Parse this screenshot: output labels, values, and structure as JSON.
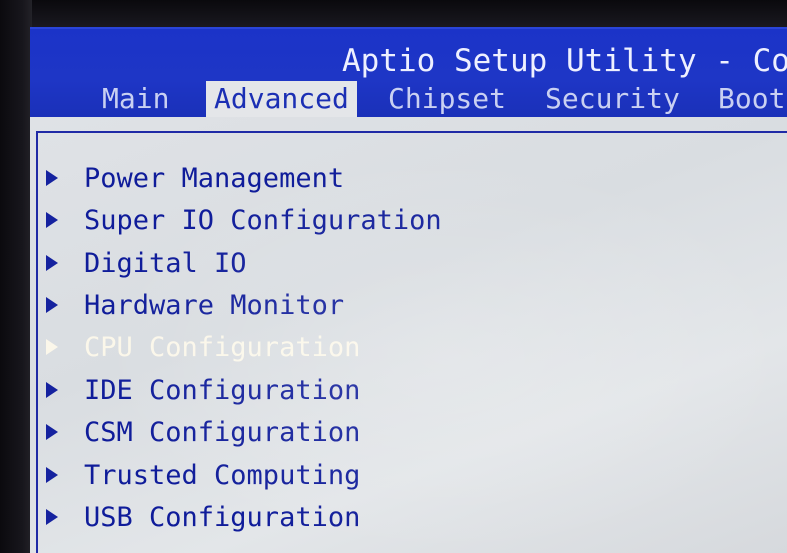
{
  "header": {
    "title": "Aptio Setup Utility - Copy",
    "tabs": [
      {
        "label": "Main",
        "active": false
      },
      {
        "label": "Advanced",
        "active": true
      },
      {
        "label": "Chipset",
        "active": false
      },
      {
        "label": "Security",
        "active": false
      },
      {
        "label": "Boot",
        "active": false
      }
    ]
  },
  "menu": {
    "selected_index": 4,
    "items": [
      {
        "label": "Power Management",
        "icon": "submenu-arrow-icon"
      },
      {
        "label": "Super IO Configuration",
        "icon": "submenu-arrow-icon"
      },
      {
        "label": "Digital IO",
        "icon": "submenu-arrow-icon"
      },
      {
        "label": "Hardware Monitor",
        "icon": "submenu-arrow-icon"
      },
      {
        "label": "CPU Configuration",
        "icon": "submenu-arrow-icon"
      },
      {
        "label": "IDE Configuration",
        "icon": "submenu-arrow-icon"
      },
      {
        "label": "CSM Configuration",
        "icon": "submenu-arrow-icon"
      },
      {
        "label": "Trusted Computing",
        "icon": "submenu-arrow-icon"
      },
      {
        "label": "USB Configuration",
        "icon": "submenu-arrow-icon"
      }
    ]
  },
  "colors": {
    "header_blue": "#1e36c6",
    "body_gray": "#dfe2e6",
    "item_text": "#0f1c9a",
    "selected_text": "#fbf7ea"
  }
}
